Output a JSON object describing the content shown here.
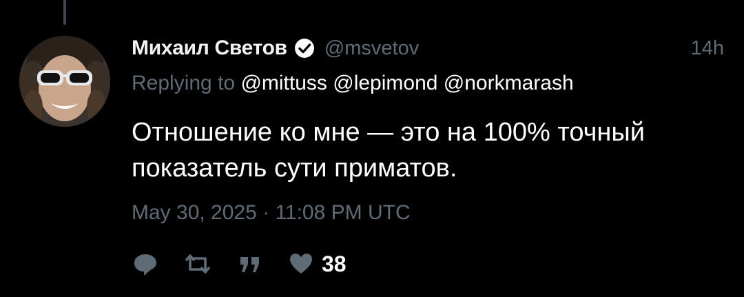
{
  "tweet": {
    "display_name": "Михаил Светов",
    "handle": "@msvetov",
    "time": "14h",
    "replying_to_label": "Replying to",
    "mentions": [
      "@mittuss",
      "@lepimond",
      "@norkmarash"
    ],
    "text": "Отношение ко мне — это на 100% точный показатель сути приматов.",
    "timestamp": "May 30, 2025 · 11:08 PM UTC",
    "like_count": "38"
  },
  "icons": {
    "verified": "verified-badge-icon",
    "reply": "comment-bubble-icon",
    "retweet": "retweet-icon",
    "quote": "quote-icon",
    "like": "heart-icon"
  },
  "colors": {
    "background": "#000000",
    "muted_text": "#5f6b75",
    "primary_text": "#ffffff"
  }
}
